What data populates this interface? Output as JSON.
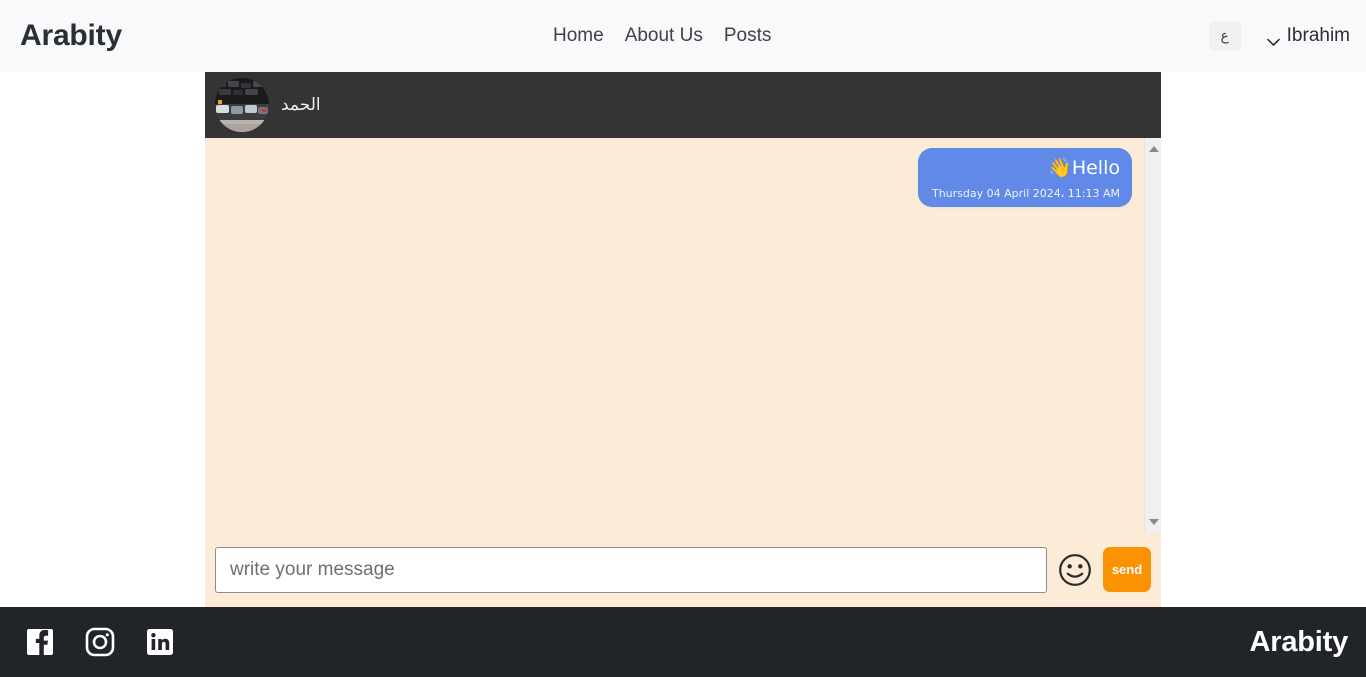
{
  "navbar": {
    "brand": "Arabity",
    "links": [
      {
        "label": "Home"
      },
      {
        "label": "About Us"
      },
      {
        "label": "Posts"
      }
    ],
    "language_button": "ع",
    "user_name": "Ibrahim",
    "chevron_icon": "chevron-down-icon"
  },
  "chat": {
    "peer_name": "الحمد",
    "avatar_icon": "user-avatar-image",
    "messages": [
      {
        "text": "👋Hello",
        "time": "Thursday 04 April 2024، 11:13 AM",
        "side": "outgoing"
      }
    ],
    "scrollbar": {
      "up_icon": "scroll-up-arrow-icon",
      "down_icon": "scroll-down-arrow-icon"
    }
  },
  "composer": {
    "input_value": "",
    "input_placeholder": "write your message",
    "emoji_icon": "emoji-smiley-icon",
    "send_label": "send"
  },
  "footer": {
    "brand": "Arabity",
    "socials": [
      {
        "name": "facebook-icon"
      },
      {
        "name": "instagram-icon"
      },
      {
        "name": "linkedin-icon"
      }
    ]
  },
  "colors": {
    "navbar_bg": "#f8f9fa",
    "chat_header_bg": "#343434",
    "chat_body_bg": "#fbebd7",
    "bubble_bg": "#6189e8",
    "send_bg": "#fb9204",
    "footer_bg": "#212529"
  }
}
